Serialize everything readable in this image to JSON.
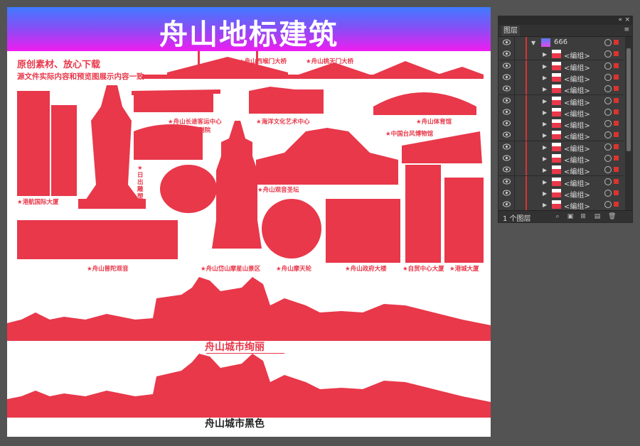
{
  "artboard": {
    "banner_title": "舟山地标建筑",
    "note_line1": "原创素材、放心下载",
    "note_line2": "源文件实际内容和预览图展示内容一致",
    "landmarks": {
      "xihoumen": "★舟山西堠门大桥",
      "taoyaomen": "★舟山桃天门大桥",
      "changtu": "★舟山长途客运中心",
      "putuo_theatre": "★普陀大剧院",
      "ocean_art": "★海洋文化艺术中心",
      "sports": "★舟山体育馆",
      "museum": "★中国台风博物馆",
      "sunrise": "★日出雕塑",
      "guanyin_altar": "★舟山观音圣坛",
      "port_aviation": "★港航国际大厦",
      "putuo_guanyin": "★舟山普陀观音",
      "daishan": "★舟山岱山摩星山景区",
      "ferris": "★舟山摩天轮",
      "gov": "★舟山政府大楼",
      "trade": "★自贸中心大厦",
      "port_city": "★港城大厦"
    },
    "skyline_caption_1": "舟山城市绚丽",
    "skyline_caption_2": "舟山城市黑色",
    "colors": {
      "landmark": "#e8384a",
      "banner_top": "#3f7bff",
      "banner_bottom": "#f01cf0"
    }
  },
  "layers_panel": {
    "tab_label": "图层",
    "collapse_icon": "double-chevron-icon",
    "rows": [
      {
        "name": "666",
        "type": "layer"
      },
      {
        "name": "<编组>",
        "type": "group"
      },
      {
        "name": "<编组>",
        "type": "group"
      },
      {
        "name": "<编组>",
        "type": "group"
      },
      {
        "name": "<编组>",
        "type": "group"
      },
      {
        "name": "<编组>",
        "type": "group"
      },
      {
        "name": "<编组>",
        "type": "group"
      },
      {
        "name": "<编组>",
        "type": "group"
      },
      {
        "name": "<编组>",
        "type": "group"
      },
      {
        "name": "<编组>",
        "type": "group"
      },
      {
        "name": "<编组>",
        "type": "group"
      },
      {
        "name": "<编组>",
        "type": "group"
      },
      {
        "name": "<编组>",
        "type": "group"
      },
      {
        "name": "<编组>",
        "type": "group"
      },
      {
        "name": "<编组>",
        "type": "group"
      }
    ],
    "layer_count": "1 个图层"
  }
}
